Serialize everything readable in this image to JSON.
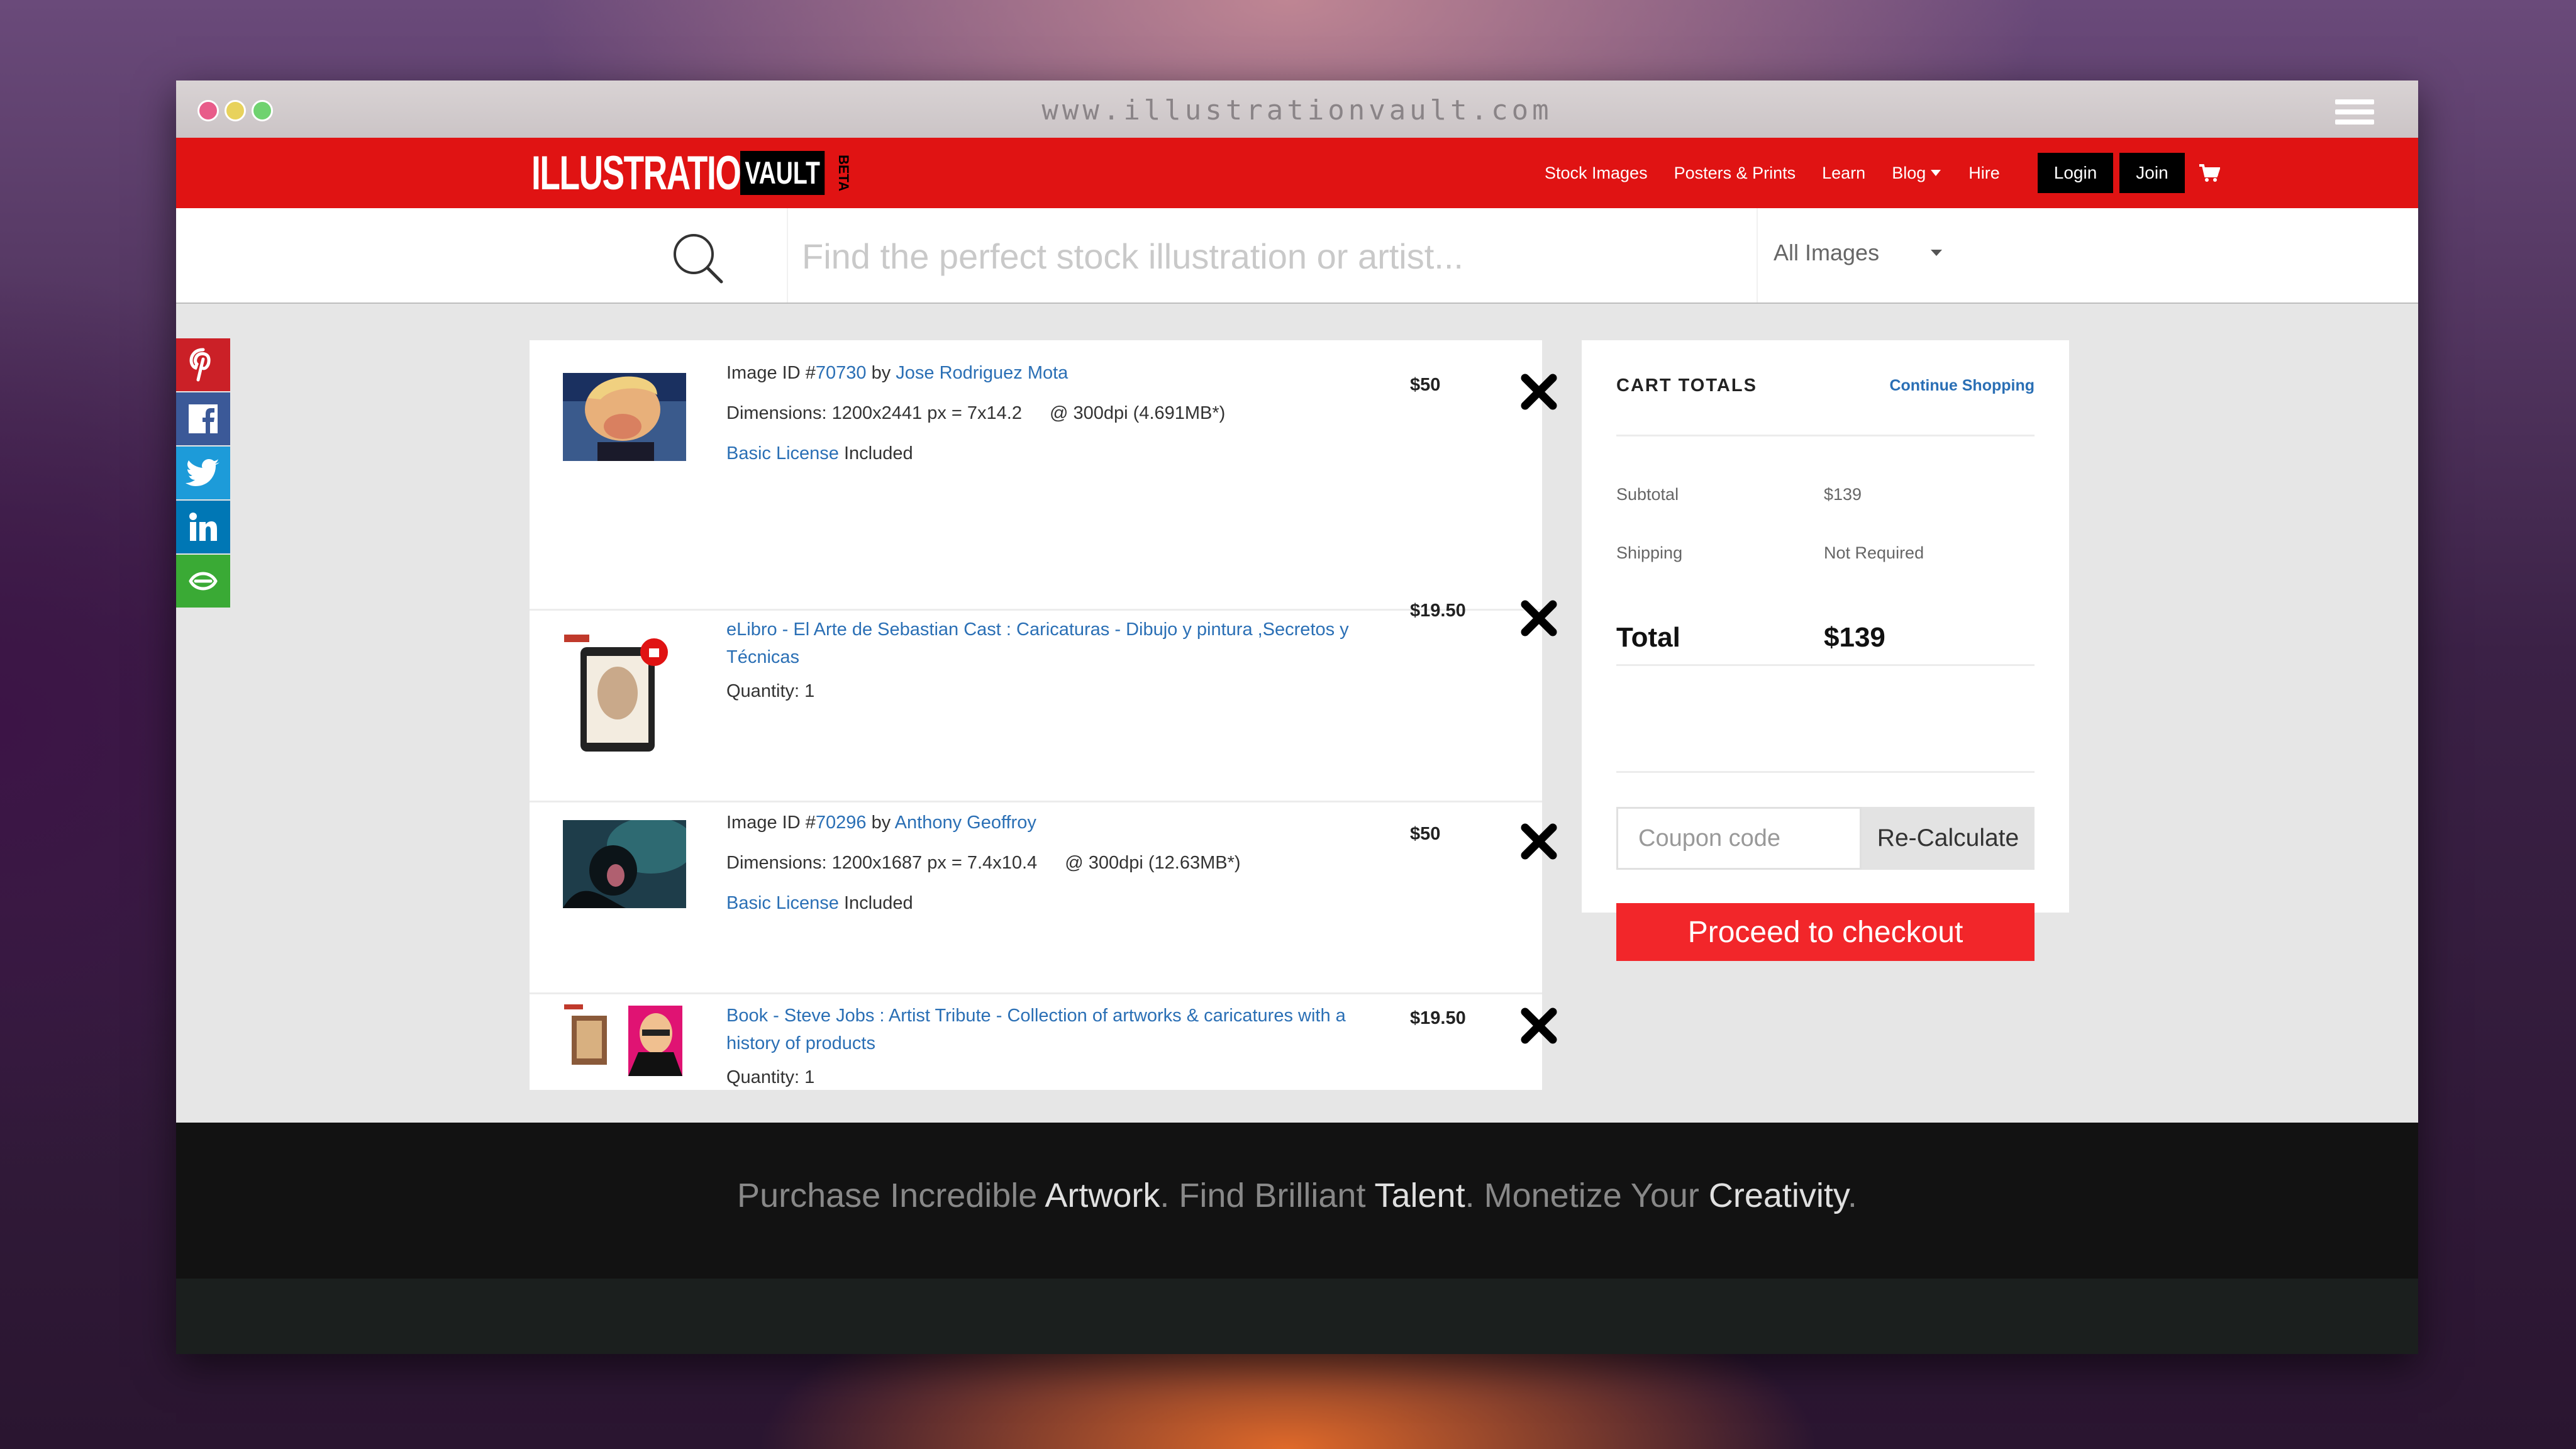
{
  "browser": {
    "url": "www.illustrationvault.com"
  },
  "nav": {
    "logo_main": "ILLUSTRATION",
    "logo_vault": "VAULT",
    "logo_beta": "BETA",
    "links": [
      "Stock Images",
      "Posters & Prints",
      "Learn",
      "Blog",
      "Hire"
    ],
    "login_label": "Login",
    "join_label": "Join"
  },
  "search": {
    "placeholder": "Find the perfect stock illustration or artist...",
    "category_selected": "All Images"
  },
  "social": [
    "pinterest",
    "facebook",
    "twitter",
    "linkedin",
    "more-share"
  ],
  "cart": {
    "items": [
      {
        "prefix": "Image ID #",
        "image_id": "70730",
        "by": "by",
        "artist": "Jose Rodriguez Mota",
        "dimensions": "Dimensions: 1200x2441 px = 7x14.2",
        "dpi": "@ 300dpi (4.691MB*)",
        "license": "Basic License",
        "included": "Included",
        "price": "$50"
      },
      {
        "title": "eLibro - El Arte de Sebastian Cast : Caricaturas - Dibujo y pintura ,Secretos y Técnicas",
        "quantity_label": "Quantity:",
        "quantity": "1",
        "price": "$19.50"
      },
      {
        "prefix": "Image ID #",
        "image_id": "70296",
        "by": "by",
        "artist": "Anthony Geoffroy",
        "dimensions": "Dimensions: 1200x1687 px = 7.4x10.4",
        "dpi": "@ 300dpi (12.63MB*)",
        "license": "Basic License",
        "included": "Included",
        "price": "$50"
      },
      {
        "title": "Book - Steve Jobs : Artist Tribute - Collection of artworks & caricatures with a history of products",
        "quantity_label": "Quantity:",
        "quantity": "1",
        "price": "$19.50"
      }
    ]
  },
  "totals": {
    "title": "CART TOTALS",
    "continue_label": "Continue Shopping",
    "subtotal_label": "Subtotal",
    "subtotal_value": "$139",
    "shipping_label": "Shipping",
    "shipping_value": "Not Required",
    "total_label": "Total",
    "total_value": "$139",
    "coupon_placeholder": "Coupon code",
    "recalc_label": "Re-Calculate",
    "checkout_label": "Proceed to checkout"
  },
  "footer": {
    "t1": "Purchase Incredible ",
    "t2": "Artwork",
    "t3": ". Find Brilliant ",
    "t4": "Talent",
    "t5": ". Monetize Your ",
    "t6": "Creativity",
    "t7": "."
  },
  "colors": {
    "brand_red": "#e01313",
    "checkout_red": "#f2262a",
    "link_blue": "#2a6fb5"
  }
}
